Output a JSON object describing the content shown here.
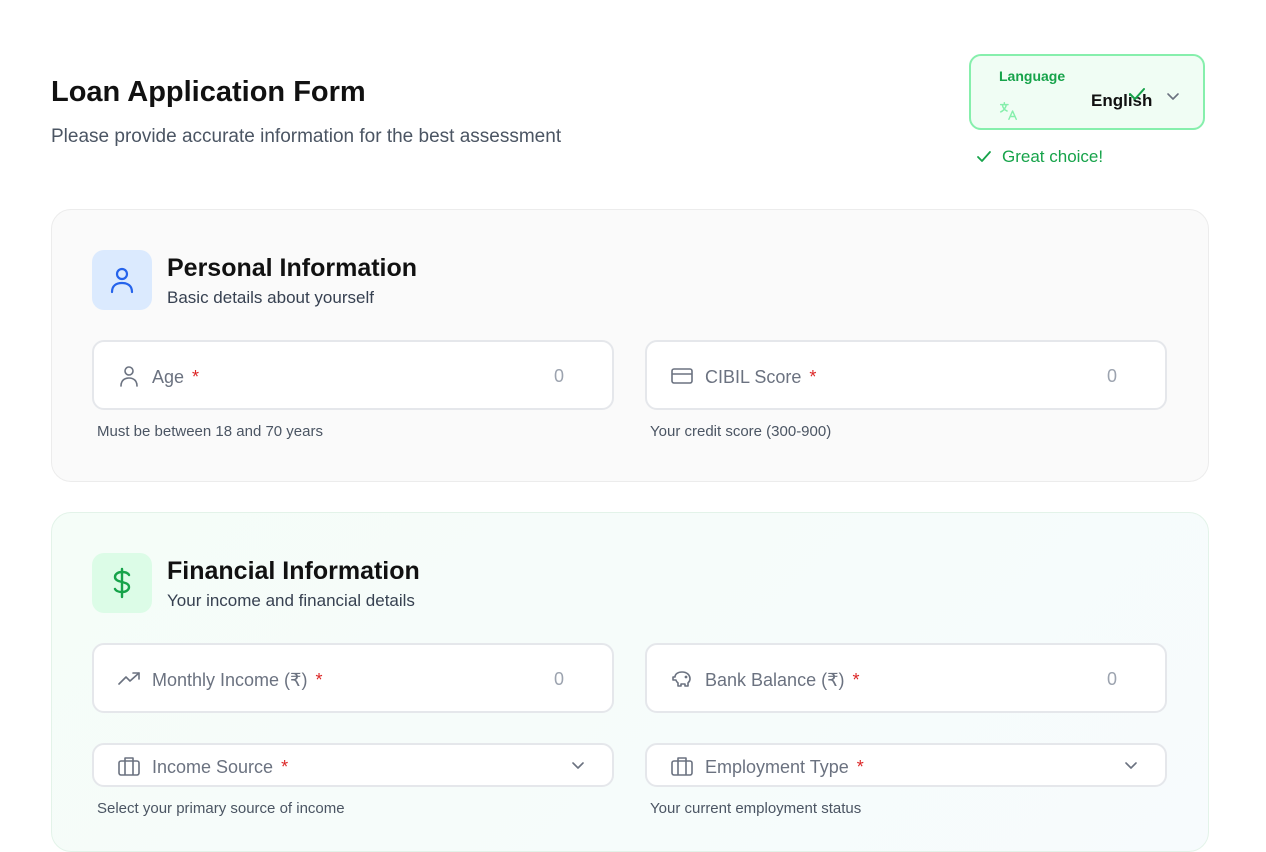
{
  "header": {
    "title": "Loan Application Form",
    "subtitle": "Please provide accurate information for the best assessment"
  },
  "language": {
    "label": "Language",
    "selected": "English",
    "confirmation": "Great choice!",
    "icon": "translate-icon"
  },
  "personal": {
    "title": "Personal Information",
    "description": "Basic details about yourself",
    "fields": [
      {
        "label": "Age",
        "value": "0",
        "hint": "Must be between 18 and 70 years",
        "icon": "user-icon"
      },
      {
        "label": "CIBIL Score",
        "value": "0",
        "hint": "Your credit score (300-900)",
        "icon": "credit-card-icon"
      }
    ]
  },
  "financial": {
    "title": "Financial Information",
    "description": "Your income and financial details",
    "fields": [
      {
        "label": "Monthly Income (₹)",
        "value": "0",
        "icon": "trending-up-icon"
      },
      {
        "label": "Bank Balance (₹)",
        "value": "0",
        "icon": "piggy-bank-icon"
      }
    ],
    "selects": [
      {
        "label": "Income Source",
        "hint": "Select your primary source of income",
        "icon": "briefcase-icon"
      },
      {
        "label": "Employment Type",
        "hint": "Your current employment status",
        "icon": "briefcase-icon"
      }
    ]
  },
  "required_marker": "*",
  "colors": {
    "accent_green": "#16a34a",
    "accent_blue": "#2563eb",
    "required": "#dc2626"
  }
}
